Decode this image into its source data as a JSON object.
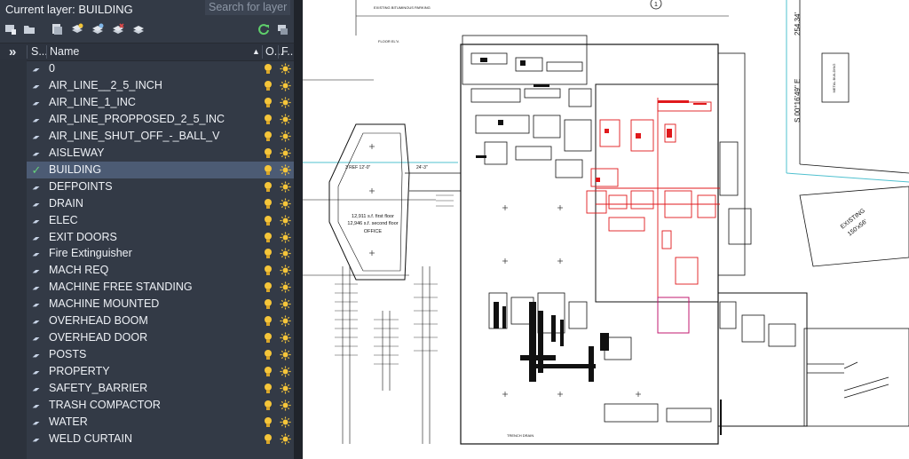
{
  "panel": {
    "current_layer": "Current layer: BUILDING",
    "search_placeholder": "Search for layer",
    "toolbar_icons": [
      "new-property-filter-icon",
      "new-group-filter-icon",
      "layer-states-icon",
      "new-layer-icon",
      "new-layer-vp-frozen-icon",
      "delete-layer-icon",
      "set-current-icon",
      "refresh-icon",
      "settings-icon"
    ],
    "columns": {
      "status": "S...",
      "name": "Name",
      "on": "O...",
      "freeze": "F..."
    },
    "expand_glyph": "»",
    "layers": [
      {
        "name": "0",
        "current": false
      },
      {
        "name": "AIR_LINE__2_5_INCH",
        "current": false
      },
      {
        "name": "AIR_LINE_1_INC",
        "current": false
      },
      {
        "name": "AIR_LINE_PROPPOSED_2_5_INC",
        "current": false
      },
      {
        "name": "AIR_LINE_SHUT_OFF_-_BALL_V",
        "current": false
      },
      {
        "name": "AISLEWAY",
        "current": false
      },
      {
        "name": "BUILDING",
        "current": true
      },
      {
        "name": "DEFPOINTS",
        "current": false
      },
      {
        "name": "DRAIN",
        "current": false
      },
      {
        "name": "ELEC",
        "current": false
      },
      {
        "name": "EXIT DOORS",
        "current": false
      },
      {
        "name": "Fire Extinguisher",
        "current": false
      },
      {
        "name": "MACH REQ",
        "current": false
      },
      {
        "name": "MACHINE FREE STANDING",
        "current": false
      },
      {
        "name": "MACHINE MOUNTED",
        "current": false
      },
      {
        "name": "OVERHEAD BOOM",
        "current": false
      },
      {
        "name": "OVERHEAD DOOR",
        "current": false
      },
      {
        "name": "POSTS",
        "current": false
      },
      {
        "name": "PROPERTY",
        "current": false
      },
      {
        "name": "SAFETY_BARRIER",
        "current": false
      },
      {
        "name": "TRASH COMPACTOR",
        "current": false
      },
      {
        "name": "WATER",
        "current": false
      },
      {
        "name": "WELD CURTAIN",
        "current": false
      }
    ]
  },
  "drawing": {
    "grid_marker": "1",
    "bearing_label": "S 00°16'49\" E",
    "distance_label": "254.34'",
    "existing_label": "EXISTING",
    "existing_dim": "150'x56'",
    "parking_label": "EXISTING BITUMINOUS PARKING",
    "office_area_1": "12,911 s.f. first floor",
    "office_area_2": "12,946 s.f. second floor",
    "office_label": "OFFICE",
    "dim_label": "3 REF 12'-0\"",
    "dim_label_2": "24'-3\"",
    "floor_label": "FLOOR EL'V.",
    "metal_label": "METAL BUILDING",
    "trench_label": "TRENCH DRAIN",
    "accent_red": "#e0191c",
    "accent_magenta": "#c2186f",
    "accent_cyan": "#4fc0cf"
  }
}
